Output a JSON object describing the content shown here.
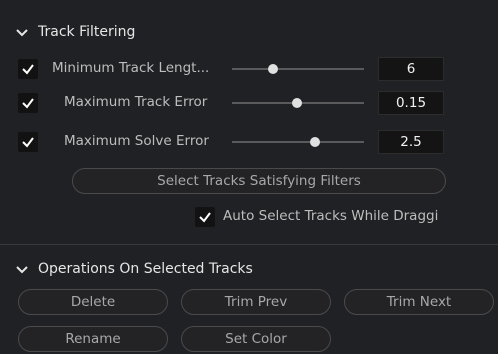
{
  "track_filtering": {
    "title": "Track Filtering",
    "rows": [
      {
        "label": "Minimum Track Lengt...",
        "value": "6",
        "checked": true
      },
      {
        "label": "Maximum Track Error",
        "value": "0.15",
        "checked": true
      },
      {
        "label": "Maximum Solve Error",
        "value": "2.5",
        "checked": true
      }
    ],
    "select_button": "Select Tracks Satisfying Filters",
    "auto_select_label": "Auto Select Tracks While Draggi"
  },
  "operations": {
    "title": "Operations On Selected Tracks",
    "buttons": {
      "delete": "Delete",
      "trim_prev": "Trim Prev",
      "trim_next": "Trim Next",
      "rename": "Rename",
      "set_color": "Set Color"
    }
  },
  "colors": {
    "background": "#202124",
    "checkbox_bg": "#121212",
    "pill_border": "#4a4a4c"
  }
}
